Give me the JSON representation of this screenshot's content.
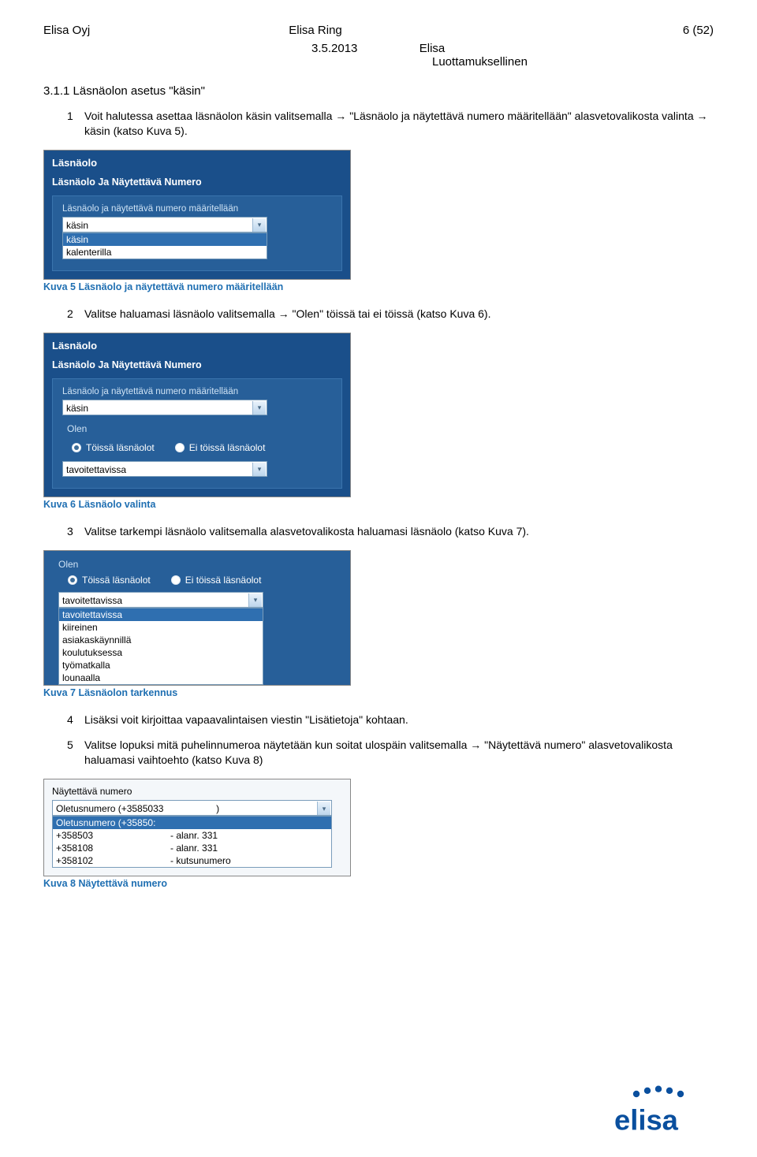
{
  "header": {
    "company": "Elisa Oyj",
    "product": "Elisa Ring",
    "page": "6 (52)",
    "date": "3.5.2013",
    "doc_label1": "Elisa",
    "doc_label2": "Luottamuksellinen"
  },
  "section": {
    "number": "3.1.1 Läsnäolon asetus \"käsin\""
  },
  "step1": {
    "n": "1",
    "text": "Voit halutessa asettaa läsnäolon käsin valitsemalla → \"Läsnäolo ja näytettävä numero määritellään\" alasvetovalikosta valinta → käsin (katso Kuva 5)."
  },
  "fig5": {
    "title": "Läsnäolo",
    "subtitle": "Läsnäolo Ja Näytettävä Numero",
    "field_label": "Läsnäolo ja näytettävä numero määritellään",
    "selected": "käsin",
    "options": [
      "käsin",
      "kalenterilla"
    ]
  },
  "cap5": "Kuva 5 Läsnäolo ja näytettävä numero määritellään",
  "step2": {
    "n": "2",
    "text": "Valitse haluamasi läsnäolo valitsemalla → \"Olen\" töissä tai ei töissä (katso Kuva 6)."
  },
  "fig6": {
    "title": "Läsnäolo",
    "subtitle": "Läsnäolo Ja Näytettävä Numero",
    "field_label": "Läsnäolo ja näytettävä numero määritellään",
    "selected": "käsin",
    "olen": "Olen",
    "r1": "Töissä läsnäolot",
    "r2": "Ei töissä läsnäolot",
    "status_selected": "tavoitettavissa"
  },
  "cap6": "Kuva 6 Läsnäolo valinta",
  "step3": {
    "n": "3",
    "text": "Valitse tarkempi läsnäolo valitsemalla alasvetovalikosta haluamasi läsnäolo (katso Kuva 7)."
  },
  "fig7": {
    "olen": "Olen",
    "r1": "Töissä läsnäolot",
    "r2": "Ei töissä läsnäolot",
    "selected": "tavoitettavissa",
    "options": [
      "tavoitettavissa",
      "tavoitettavissa",
      "kiireinen",
      "asiakaskäynnillä",
      "koulutuksessa",
      "työmatkalla",
      "lounaalla"
    ]
  },
  "cap7": "Kuva 7 Läsnäolon tarkennus",
  "step4": {
    "n": "4",
    "text": "Lisäksi voit kirjoittaa vapaavalintaisen viestin \"Lisätietoja\" kohtaan."
  },
  "step5": {
    "n": "5",
    "text": "Valitse lopuksi mitä puhelinnumeroa näytetään kun soitat ulospäin valitsemalla → \"Näytettävä numero\" alasvetovalikosta haluamasi vaihtoehto (katso Kuva 8)"
  },
  "fig8": {
    "label": "Näytettävä numero",
    "selected_left": "Oletusnumero (+3585033",
    "selected_right": ")",
    "rows": [
      {
        "c1": "Oletusnumero (+35850:",
        "c2": "",
        "sel": true
      },
      {
        "c1": "+358503",
        "c2": "- alanr. 331",
        "sel": false
      },
      {
        "c1": "+358108",
        "c2": "- alanr. 331",
        "sel": false
      },
      {
        "c1": "+358102",
        "c2": "- kutsunumero",
        "sel": false
      }
    ]
  },
  "cap8": "Kuva 8 Näytettävä numero"
}
